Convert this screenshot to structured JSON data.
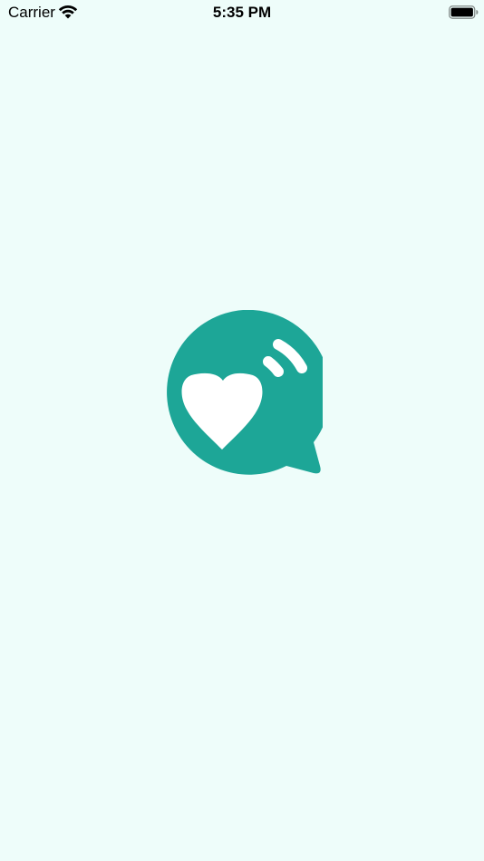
{
  "status_bar": {
    "carrier": "Carrier",
    "time": "5:35 PM",
    "icons": [
      "wifi-icon",
      "battery-icon"
    ]
  },
  "splash": {
    "logo": "chat-bubble-heart-logo",
    "colors": {
      "background": "#EEFDFA",
      "brand": "#1DA697",
      "glyph": "#FFFFFF"
    }
  }
}
